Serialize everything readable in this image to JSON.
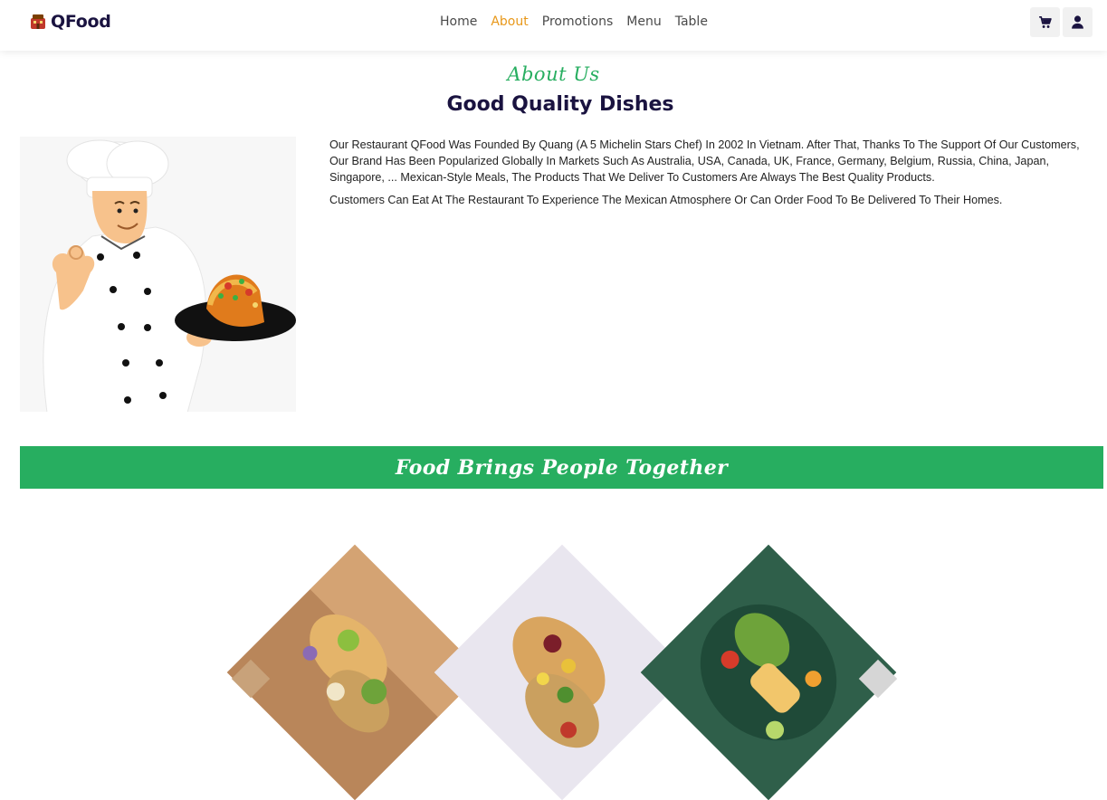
{
  "header": {
    "brand": "QFood",
    "nav": [
      {
        "label": "Home",
        "active": false
      },
      {
        "label": "About",
        "active": true
      },
      {
        "label": "Promotions",
        "active": false
      },
      {
        "label": "Menu",
        "active": false
      },
      {
        "label": "Table",
        "active": false
      }
    ],
    "icons": [
      "cart-icon",
      "user-icon"
    ]
  },
  "about": {
    "eyebrow": "About Us",
    "title": "Good Quality Dishes",
    "paragraphs": [
      "Our Restaurant QFood Was Founded By Quang (A 5 Michelin Stars Chef) In 2002 In Vietnam. After That, Thanks To The Support Of Our Customers, Our Brand Has Been Popularized Globally In Markets Such As Australia, USA, Canada, UK, France, Germany, Belgium, Russia, China, Japan, Singapore, ... Mexican-Style Meals, The Products That We Deliver To Customers Are Always The Best Quality Products.",
      "Customers Can Eat At The Restaurant To Experience The Mexican Atmosphere Or Can Order Food To Be Delivered To Their Homes."
    ]
  },
  "banner": {
    "text": "Food Brings People Together"
  },
  "colors": {
    "accent": "#27ae60",
    "active_nav": "#e8981a",
    "title": "#1a1340"
  }
}
